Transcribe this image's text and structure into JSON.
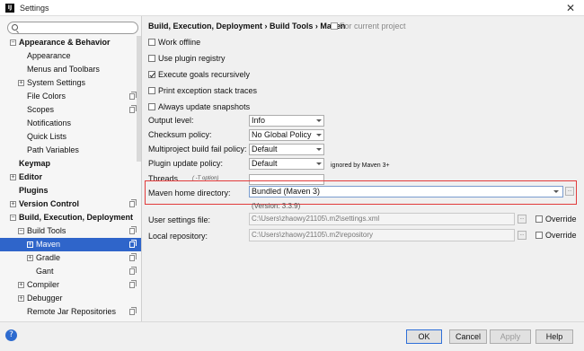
{
  "window": {
    "title": "Settings",
    "app_icon": "IJ"
  },
  "search": {
    "value": "",
    "placeholder": ""
  },
  "tree": [
    {
      "label": "Appearance & Behavior",
      "bold": true,
      "expander": "minus"
    },
    {
      "label": "Appearance"
    },
    {
      "label": "Menus and Toolbars"
    },
    {
      "label": "System Settings",
      "expander": "plus"
    },
    {
      "label": "File Colors",
      "copy_icon": true
    },
    {
      "label": "Scopes",
      "copy_icon": true
    },
    {
      "label": "Notifications"
    },
    {
      "label": "Quick Lists"
    },
    {
      "label": "Path Variables"
    },
    {
      "label": "Keymap",
      "bold": true
    },
    {
      "label": "Editor",
      "bold": true,
      "expander": "plus"
    },
    {
      "label": "Plugins",
      "bold": true
    },
    {
      "label": "Version Control",
      "bold": true,
      "expander": "plus",
      "copy_icon": true
    },
    {
      "label": "Build, Execution, Deployment",
      "bold": true,
      "expander": "minus"
    },
    {
      "label": "Build Tools",
      "expander": "minus",
      "copy_icon": true
    },
    {
      "label": "Maven",
      "expander": "plus",
      "copy_icon": true,
      "selected": true
    },
    {
      "label": "Gradle",
      "expander": "plus",
      "copy_icon": true
    },
    {
      "label": "Gant",
      "copy_icon": true
    },
    {
      "label": "Compiler",
      "expander": "plus",
      "copy_icon": true
    },
    {
      "label": "Debugger",
      "expander": "plus"
    },
    {
      "label": "Remote Jar Repositories",
      "copy_icon": true
    }
  ],
  "header": {
    "breadcrumb": "Build, Execution, Deployment › Build Tools › Maven",
    "for_project": "For current project"
  },
  "checkboxes": [
    {
      "label": "Work offline",
      "checked": false
    },
    {
      "label": "Use plugin registry",
      "checked": false
    },
    {
      "label": "Execute goals recursively",
      "checked": true
    },
    {
      "label": "Print exception stack traces",
      "checked": false
    },
    {
      "label": "Always update snapshots",
      "checked": false
    }
  ],
  "form": {
    "output_level": {
      "label": "Output level:",
      "value": "Info"
    },
    "checksum_policy": {
      "label": "Checksum policy:",
      "value": "No Global Policy"
    },
    "multiproject_policy": {
      "label": "Multiproject build fail policy:",
      "value": "Default"
    },
    "plugin_update_policy": {
      "label": "Plugin update policy:",
      "value": "Default",
      "note": "ignored by Maven 3+"
    },
    "threads": {
      "label": "Threads",
      "hint": "( -T option)"
    },
    "maven_home": {
      "label": "Maven home directory:",
      "value": "Bundled (Maven 3)",
      "version": "(Version: 3.3.9)"
    },
    "user_settings": {
      "label": "User settings file:",
      "value": "C:\\Users\\zhaowy21105\\.m2\\settings.xml",
      "override_label": "Override"
    },
    "local_repository": {
      "label": "Local repository:",
      "value": "C:\\Users\\zhaowy21105\\.m2\\repository",
      "override_label": "Override"
    }
  },
  "buttons": {
    "ok": "OK",
    "cancel": "Cancel",
    "apply": "Apply",
    "help": "Help"
  },
  "colors": {
    "selection": "#2f65ca",
    "highlight_box": "#e23b3b"
  }
}
